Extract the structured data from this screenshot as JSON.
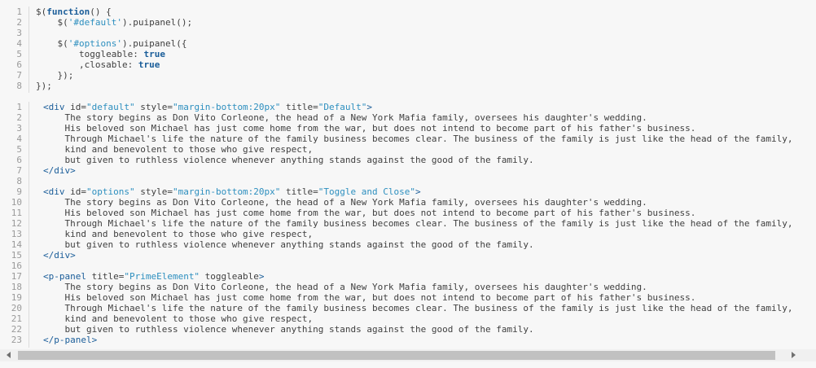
{
  "js_code": {
    "line_numbers": [
      "1",
      "2",
      "3",
      "4",
      "5",
      "6",
      "7",
      "8"
    ],
    "lines": [
      {
        "t": [
          {
            "c": "plain",
            "v": "$("
          },
          {
            "c": "kw",
            "v": "function"
          },
          {
            "c": "plain",
            "v": "() {"
          }
        ]
      },
      {
        "t": [
          {
            "c": "plain",
            "v": "    $("
          },
          {
            "c": "str",
            "v": "'#default'"
          },
          {
            "c": "plain",
            "v": ").puipanel();"
          }
        ]
      },
      {
        "t": []
      },
      {
        "t": [
          {
            "c": "plain",
            "v": "    $("
          },
          {
            "c": "str",
            "v": "'#options'"
          },
          {
            "c": "plain",
            "v": ").puipanel({"
          }
        ]
      },
      {
        "t": [
          {
            "c": "plain",
            "v": "        toggleable: "
          },
          {
            "c": "kw",
            "v": "true"
          }
        ]
      },
      {
        "t": [
          {
            "c": "plain",
            "v": "        ,closable: "
          },
          {
            "c": "kw",
            "v": "true"
          }
        ]
      },
      {
        "t": [
          {
            "c": "plain",
            "v": "    });"
          }
        ]
      },
      {
        "t": [
          {
            "c": "plain",
            "v": "});"
          }
        ]
      }
    ]
  },
  "html_code": {
    "line_numbers": [
      "1",
      "2",
      "3",
      "4",
      "5",
      "6",
      "7",
      "8",
      "9",
      "10",
      "11",
      "12",
      "13",
      "14",
      "15",
      "16",
      "17",
      "18",
      "19",
      "20",
      "21",
      "22",
      "23"
    ],
    "lines": [
      {
        "t": [
          {
            "c": "tag",
            "v": "<div"
          },
          {
            "c": "attr",
            "v": " id="
          },
          {
            "c": "val",
            "v": "\"default\""
          },
          {
            "c": "attr",
            "v": " style="
          },
          {
            "c": "val",
            "v": "\"margin-bottom:20px\""
          },
          {
            "c": "attr",
            "v": " title="
          },
          {
            "c": "val",
            "v": "\"Default\""
          },
          {
            "c": "tag",
            "v": ">"
          }
        ]
      },
      {
        "t": [
          {
            "c": "plain",
            "v": "    The story begins as Don Vito Corleone, the head of a New York Mafia family, oversees his daughter's wedding."
          }
        ]
      },
      {
        "t": [
          {
            "c": "plain",
            "v": "    His beloved son Michael has just come home from the war, but does not intend to become part of his father's business."
          }
        ]
      },
      {
        "t": [
          {
            "c": "plain",
            "v": "    Through Michael's life the nature of the family business becomes clear. The business of the family is just like the head of the family,"
          }
        ]
      },
      {
        "t": [
          {
            "c": "plain",
            "v": "    kind and benevolent to those who give respect,"
          }
        ]
      },
      {
        "t": [
          {
            "c": "plain",
            "v": "    but given to ruthless violence whenever anything stands against the good of the family."
          }
        ]
      },
      {
        "t": [
          {
            "c": "tag",
            "v": "</div>"
          }
        ]
      },
      {
        "t": []
      },
      {
        "t": [
          {
            "c": "tag",
            "v": "<div"
          },
          {
            "c": "attr",
            "v": " id="
          },
          {
            "c": "val",
            "v": "\"options\""
          },
          {
            "c": "attr",
            "v": " style="
          },
          {
            "c": "val",
            "v": "\"margin-bottom:20px\""
          },
          {
            "c": "attr",
            "v": " title="
          },
          {
            "c": "val",
            "v": "\"Toggle and Close\""
          },
          {
            "c": "tag",
            "v": ">"
          }
        ]
      },
      {
        "t": [
          {
            "c": "plain",
            "v": "    The story begins as Don Vito Corleone, the head of a New York Mafia family, oversees his daughter's wedding."
          }
        ]
      },
      {
        "t": [
          {
            "c": "plain",
            "v": "    His beloved son Michael has just come home from the war, but does not intend to become part of his father's business."
          }
        ]
      },
      {
        "t": [
          {
            "c": "plain",
            "v": "    Through Michael's life the nature of the family business becomes clear. The business of the family is just like the head of the family,"
          }
        ]
      },
      {
        "t": [
          {
            "c": "plain",
            "v": "    kind and benevolent to those who give respect,"
          }
        ]
      },
      {
        "t": [
          {
            "c": "plain",
            "v": "    but given to ruthless violence whenever anything stands against the good of the family."
          }
        ]
      },
      {
        "t": [
          {
            "c": "tag",
            "v": "</div>"
          }
        ]
      },
      {
        "t": []
      },
      {
        "t": [
          {
            "c": "tag",
            "v": "<p-panel"
          },
          {
            "c": "attr",
            "v": " title="
          },
          {
            "c": "val",
            "v": "\"PrimeElement\""
          },
          {
            "c": "attr",
            "v": " toggleable"
          },
          {
            "c": "tag",
            "v": ">"
          }
        ]
      },
      {
        "t": [
          {
            "c": "plain",
            "v": "    The story begins as Don Vito Corleone, the head of a New York Mafia family, oversees his daughter's wedding."
          }
        ]
      },
      {
        "t": [
          {
            "c": "plain",
            "v": "    His beloved son Michael has just come home from the war, but does not intend to become part of his father's business."
          }
        ]
      },
      {
        "t": [
          {
            "c": "plain",
            "v": "    Through Michael's life the nature of the family business becomes clear. The business of the family is just like the head of the family,"
          }
        ]
      },
      {
        "t": [
          {
            "c": "plain",
            "v": "    kind and benevolent to those who give respect,"
          }
        ]
      },
      {
        "t": [
          {
            "c": "plain",
            "v": "    but given to ruthless violence whenever anything stands against the good of the family."
          }
        ]
      },
      {
        "t": [
          {
            "c": "tag",
            "v": "</p-panel>"
          }
        ]
      }
    ]
  },
  "scrollbar": {
    "left_arrow_icon": "triangle-left-icon",
    "right_arrow_icon": "triangle-right-icon",
    "thumb_fraction": 0.93
  },
  "colors": {
    "background": "#f7f7f7",
    "keyword": "#1a5d99",
    "string": "#2d8fbf",
    "text": "#404040",
    "line_number": "#9a9a9a"
  }
}
